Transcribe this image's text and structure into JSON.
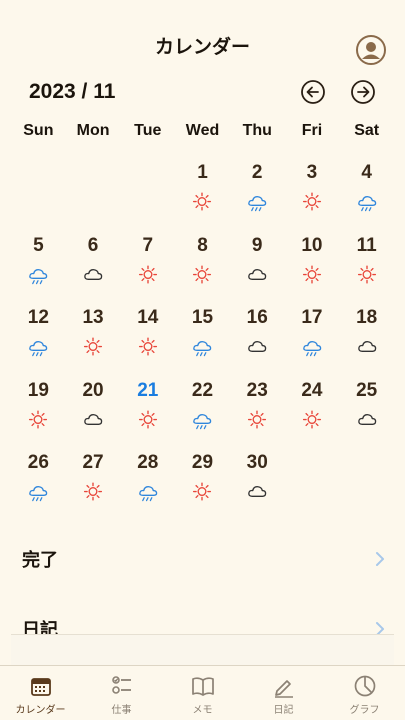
{
  "header": {
    "title": "カレンダー"
  },
  "month": {
    "label": "2023 / 11"
  },
  "weekdays": [
    "Sun",
    "Mon",
    "Tue",
    "Wed",
    "Thu",
    "Fri",
    "Sat"
  ],
  "days": [
    {
      "n": "",
      "w": ""
    },
    {
      "n": "",
      "w": ""
    },
    {
      "n": "",
      "w": ""
    },
    {
      "n": "1",
      "w": "sun"
    },
    {
      "n": "2",
      "w": "rain"
    },
    {
      "n": "3",
      "w": "sun"
    },
    {
      "n": "4",
      "w": "rain"
    },
    {
      "n": "5",
      "w": "rain"
    },
    {
      "n": "6",
      "w": "cloud"
    },
    {
      "n": "7",
      "w": "sun"
    },
    {
      "n": "8",
      "w": "sun"
    },
    {
      "n": "9",
      "w": "cloud"
    },
    {
      "n": "10",
      "w": "sun"
    },
    {
      "n": "11",
      "w": "sun"
    },
    {
      "n": "12",
      "w": "rain"
    },
    {
      "n": "13",
      "w": "sun"
    },
    {
      "n": "14",
      "w": "sun"
    },
    {
      "n": "15",
      "w": "rain"
    },
    {
      "n": "16",
      "w": "cloud"
    },
    {
      "n": "17",
      "w": "rain"
    },
    {
      "n": "18",
      "w": "cloud"
    },
    {
      "n": "19",
      "w": "sun"
    },
    {
      "n": "20",
      "w": "cloud"
    },
    {
      "n": "21",
      "w": "sun",
      "today": true
    },
    {
      "n": "22",
      "w": "rain"
    },
    {
      "n": "23",
      "w": "sun"
    },
    {
      "n": "24",
      "w": "sun"
    },
    {
      "n": "25",
      "w": "cloud"
    },
    {
      "n": "26",
      "w": "rain"
    },
    {
      "n": "27",
      "w": "sun"
    },
    {
      "n": "28",
      "w": "rain"
    },
    {
      "n": "29",
      "w": "sun"
    },
    {
      "n": "30",
      "w": "cloud"
    }
  ],
  "sections": {
    "done": "完了",
    "diary": "日記"
  },
  "tabs": [
    {
      "label": "カレンダー",
      "icon": "calendar-icon",
      "active": true
    },
    {
      "label": "仕事",
      "icon": "checklist-icon",
      "active": false
    },
    {
      "label": "メモ",
      "icon": "book-icon",
      "active": false
    },
    {
      "label": "日記",
      "icon": "pencil-icon",
      "active": false
    },
    {
      "label": "グラフ",
      "icon": "pie-chart-icon",
      "active": false
    }
  ],
  "colors": {
    "background": "#fdf8ec",
    "today": "#1a7de0",
    "sun": "#e8463a",
    "rain": "#2f86dc",
    "cloud": "#333333",
    "accent": "#8a6a4a"
  }
}
